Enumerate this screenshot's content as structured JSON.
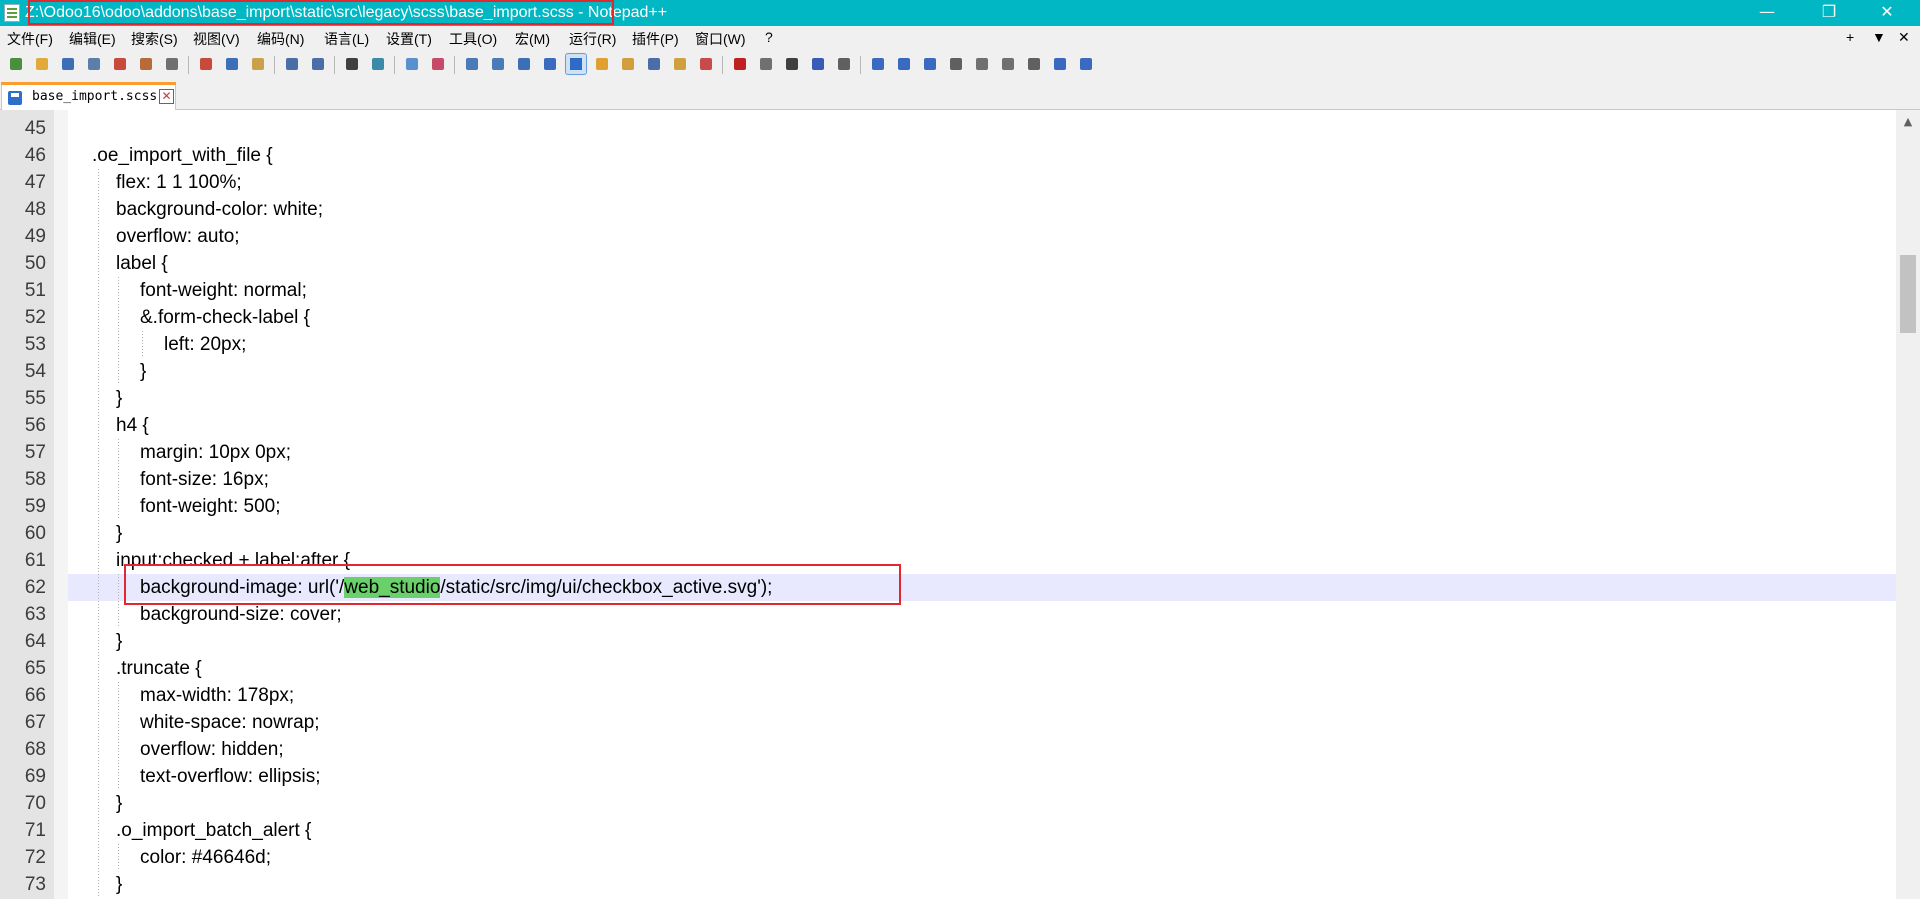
{
  "window": {
    "title": "Z:\\Odoo16\\odoo\\addons\\base_import\\static\\src\\legacy\\scss\\base_import.scss - Notepad++",
    "minimize_glyph": "—",
    "maximize_glyph": "❐",
    "close_glyph": "✕"
  },
  "menu": {
    "items": [
      "文件(F)",
      "编辑(E)",
      "搜索(S)",
      "视图(V)",
      "编码(N)",
      "语言(L)",
      "设置(T)",
      "工具(O)",
      "宏(M)",
      "运行(R)",
      "插件(P)",
      "窗口(W)",
      "?"
    ],
    "right": [
      "+",
      "▼",
      "✕"
    ]
  },
  "toolbar": {
    "icons": [
      "new-file-icon",
      "open-file-icon",
      "save-icon",
      "save-all-icon",
      "close-icon",
      "close-all-icon",
      "print-icon",
      "cut-icon",
      "copy-icon",
      "paste-icon",
      "undo-icon",
      "redo-icon",
      "find-icon",
      "replace-icon",
      "zoom-in-icon",
      "zoom-out-icon",
      "sync-vertical-icon",
      "sync-horizontal-icon",
      "word-wrap-icon",
      "show-all-chars-icon",
      "indent-guide-icon",
      "user-language-icon",
      "doc-map-icon",
      "function-list-icon",
      "folder-workspace-icon",
      "monitoring-icon",
      "record-macro-icon",
      "stop-macro-icon",
      "play-macro-icon",
      "run-macro-multiple-icon",
      "save-macro-icon",
      "plugin-1-icon",
      "plugin-2-icon",
      "plugin-3-icon",
      "plugin-4-icon",
      "plugin-5-icon",
      "plugin-6-icon",
      "plugin-7-icon",
      "plugin-8-icon",
      "plugin-9-icon"
    ]
  },
  "tab": {
    "label": "base_import.scss",
    "close_glyph": "✕"
  },
  "editor": {
    "current_line": 62,
    "lines": [
      {
        "n": "45",
        "indent": 0,
        "text": ""
      },
      {
        "n": "46",
        "indent": 0,
        "text": ".oe_import_with_file {"
      },
      {
        "n": "47",
        "indent": 1,
        "text": "flex: 1 1 100%;"
      },
      {
        "n": "48",
        "indent": 1,
        "text": "background-color: white;"
      },
      {
        "n": "49",
        "indent": 1,
        "text": "overflow: auto;"
      },
      {
        "n": "50",
        "indent": 1,
        "text": "label {"
      },
      {
        "n": "51",
        "indent": 2,
        "text": "font-weight: normal;"
      },
      {
        "n": "52",
        "indent": 2,
        "text": "&.form-check-label {"
      },
      {
        "n": "53",
        "indent": 3,
        "text": "left: 20px;"
      },
      {
        "n": "54",
        "indent": 2,
        "text": "}"
      },
      {
        "n": "55",
        "indent": 1,
        "text": "}"
      },
      {
        "n": "56",
        "indent": 1,
        "text": "h4 {"
      },
      {
        "n": "57",
        "indent": 2,
        "text": "margin: 10px 0px;"
      },
      {
        "n": "58",
        "indent": 2,
        "text": "font-size: 16px;"
      },
      {
        "n": "59",
        "indent": 2,
        "text": "font-weight: 500;"
      },
      {
        "n": "60",
        "indent": 1,
        "text": "}"
      },
      {
        "n": "61",
        "indent": 1,
        "text": "input:checked + label:after {"
      },
      {
        "n": "62",
        "indent": 2,
        "text_before": "background-image: url('/",
        "highlight": "web_studio",
        "text_after": "/static/src/img/ui/checkbox_active.svg');"
      },
      {
        "n": "63",
        "indent": 2,
        "text": "background-size: cover;"
      },
      {
        "n": "64",
        "indent": 1,
        "text": "}"
      },
      {
        "n": "65",
        "indent": 1,
        "text": ".truncate {"
      },
      {
        "n": "66",
        "indent": 2,
        "text": "max-width: 178px;"
      },
      {
        "n": "67",
        "indent": 2,
        "text": "white-space: nowrap;"
      },
      {
        "n": "68",
        "indent": 2,
        "text": "overflow: hidden;"
      },
      {
        "n": "69",
        "indent": 2,
        "text": "text-overflow: ellipsis;"
      },
      {
        "n": "70",
        "indent": 1,
        "text": "}"
      },
      {
        "n": "71",
        "indent": 1,
        "text": ".o_import_batch_alert {"
      },
      {
        "n": "72",
        "indent": 2,
        "text": "color: #46646d;"
      },
      {
        "n": "73",
        "indent": 1,
        "text": "}"
      }
    ]
  },
  "scrollbar": {
    "up_glyph": "▲"
  },
  "colors": {
    "titlebar": "#00b7c3",
    "tab_accent": "#fa9d2f",
    "current_line": "#e8e8ff",
    "highlight": "#6ad16a",
    "annotation": "#e0282e"
  }
}
